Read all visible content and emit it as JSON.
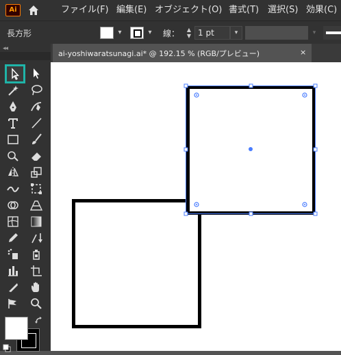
{
  "menubar": {
    "logo": "Ai",
    "items": [
      "ファイル(F)",
      "編集(E)",
      "オブジェクト(O)",
      "書式(T)",
      "選択(S)",
      "効果(C)"
    ]
  },
  "controlbar": {
    "object_type": "長方形",
    "stroke_label": "線：",
    "stroke_weight": "1 pt"
  },
  "document": {
    "tab_title": "ai-yoshiwaratsunagi.ai* @ 192.15 % (RGB/プレビュー)",
    "close_glyph": "×"
  },
  "toolbar": {
    "active_tool": "selection-tool",
    "highlight_color": "#1fb4a8"
  },
  "colors": {
    "fill": "#ffffff",
    "stroke": "#000000",
    "selection": "#4a7dff",
    "ui_bg": "#323232",
    "canvas_bg": "#535353"
  }
}
